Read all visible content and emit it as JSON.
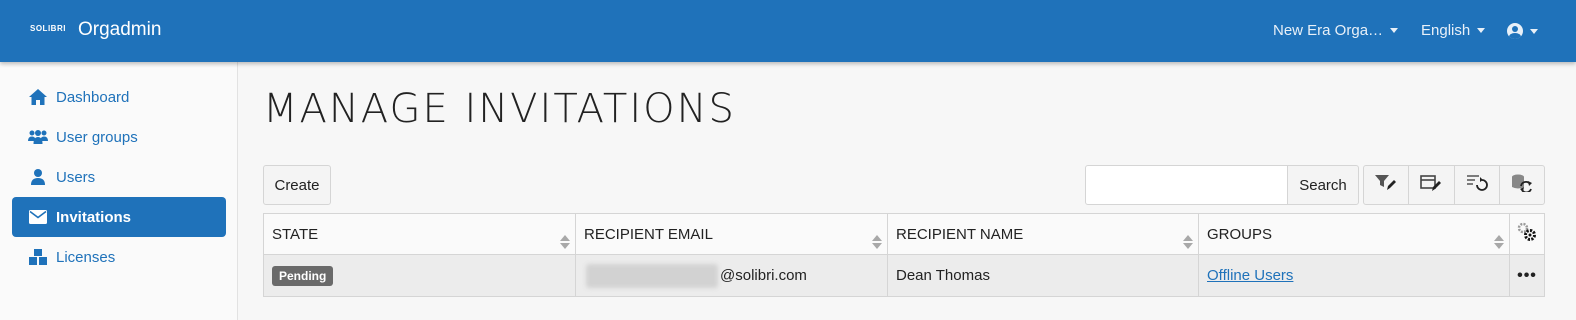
{
  "header": {
    "logo_text": "SOLIBRI",
    "app_name": "Orgadmin",
    "organization": "New Era Orga…",
    "language": "English"
  },
  "sidebar": {
    "items": [
      {
        "label": "Dashboard",
        "icon": "home-icon"
      },
      {
        "label": "User groups",
        "icon": "users-icon"
      },
      {
        "label": "Users",
        "icon": "user-icon"
      },
      {
        "label": "Invitations",
        "icon": "envelope-icon",
        "active": true
      },
      {
        "label": "Licenses",
        "icon": "boxes-icon"
      }
    ]
  },
  "main": {
    "title": "MANAGE INVITATIONS",
    "create_label": "Create",
    "search_label": "Search",
    "search_value": ""
  },
  "table": {
    "columns": [
      "STATE",
      "RECIPIENT EMAIL",
      "RECIPIENT NAME",
      "GROUPS"
    ],
    "rows": [
      {
        "state": "Pending",
        "email_domain": "@solibri.com",
        "name": "Dean Thomas",
        "groups": "Offline Users"
      }
    ]
  },
  "colors": {
    "accent": "#1f72ba",
    "badge": "#6a6a6a"
  }
}
